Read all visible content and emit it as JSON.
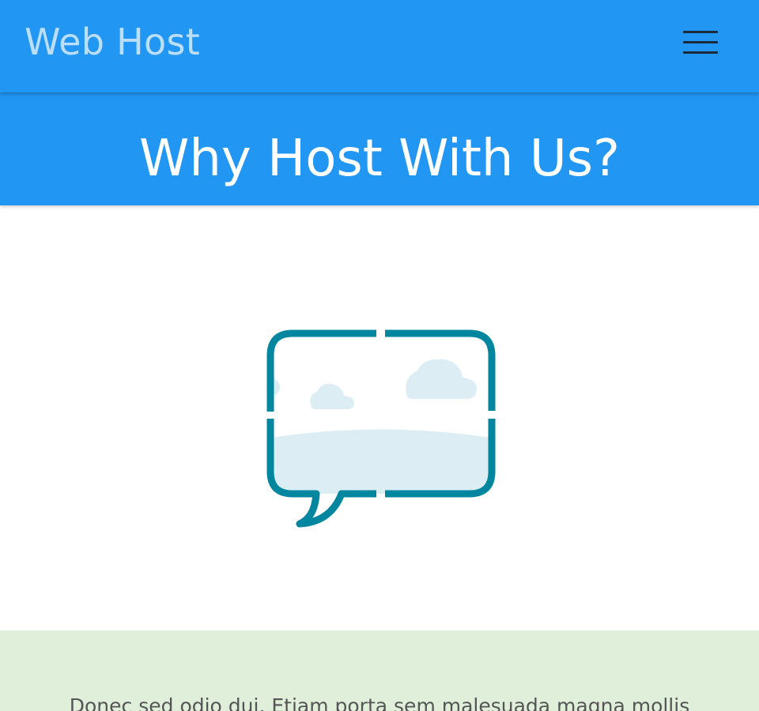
{
  "navbar": {
    "brand": "Web Host",
    "menu_icon": "hamburger-menu-icon"
  },
  "hero": {
    "title": "Why Host With Us?"
  },
  "feature_image": {
    "icon": "image-placeholder-speech-bubble-icon"
  },
  "content": {
    "paragraph": "Donec sed odio dui. Etiam porta sem malesuada magna mollis"
  },
  "colors": {
    "primary": "#2196f3",
    "brand_text": "#bbdefb",
    "hero_text": "#ffffff",
    "icon_stroke": "#00869e",
    "icon_fill": "#dceef3",
    "section_green": "#dfefda",
    "body_text": "#555555"
  }
}
